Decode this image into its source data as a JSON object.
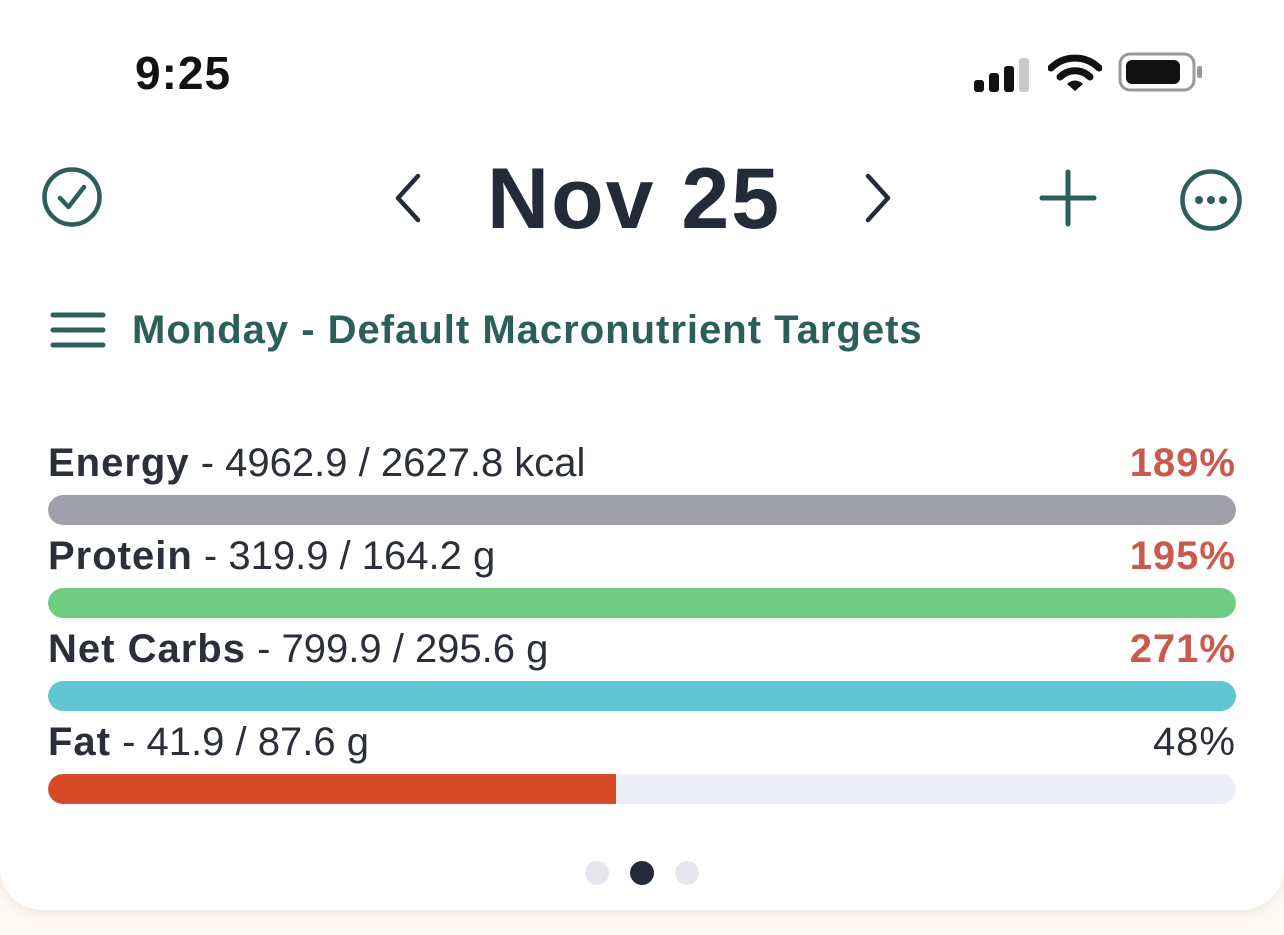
{
  "status_bar": {
    "time": "9:25",
    "icons": [
      "cellular-signal-icon",
      "wifi-icon",
      "battery-icon"
    ]
  },
  "header": {
    "date_title": "Nov 25",
    "left_icon": "checkmark-circle-icon",
    "prev_icon": "chevron-left-icon",
    "next_icon": "chevron-right-icon",
    "add_icon": "plus-icon",
    "more_icon": "ellipsis-circle-icon"
  },
  "targets": {
    "menu_icon": "hamburger-menu-icon",
    "label": "Monday - Default Macronutrient Targets"
  },
  "macros": [
    {
      "name": "Energy",
      "detail": " - 4962.9 / 2627.8 kcal",
      "percent_label": "189%",
      "progress": 1.0,
      "bar_color": "#9e9fab",
      "pct_color": "#c95a4d"
    },
    {
      "name": "Protein",
      "detail": " - 319.9 / 164.2 g",
      "percent_label": "195%",
      "progress": 1.0,
      "bar_color": "#70cc80",
      "pct_color": "#c95a4d"
    },
    {
      "name": "Net Carbs",
      "detail": " - 799.9 / 295.6 g",
      "percent_label": "271%",
      "progress": 1.0,
      "bar_color": "#60c6d4",
      "pct_color": "#c95a4d"
    },
    {
      "name": "Fat",
      "detail": " - 41.9 / 87.6 g",
      "percent_label": "48%",
      "progress": 0.478,
      "bar_color": "#d64b25",
      "pct_color": "#2b2f3a"
    }
  ],
  "pager": {
    "count": 3,
    "active_index": 1
  },
  "colors": {
    "accent": "#2c5e5a",
    "title": "#232a3a",
    "over_target": "#c95a4d",
    "track": "#eeeef6"
  }
}
